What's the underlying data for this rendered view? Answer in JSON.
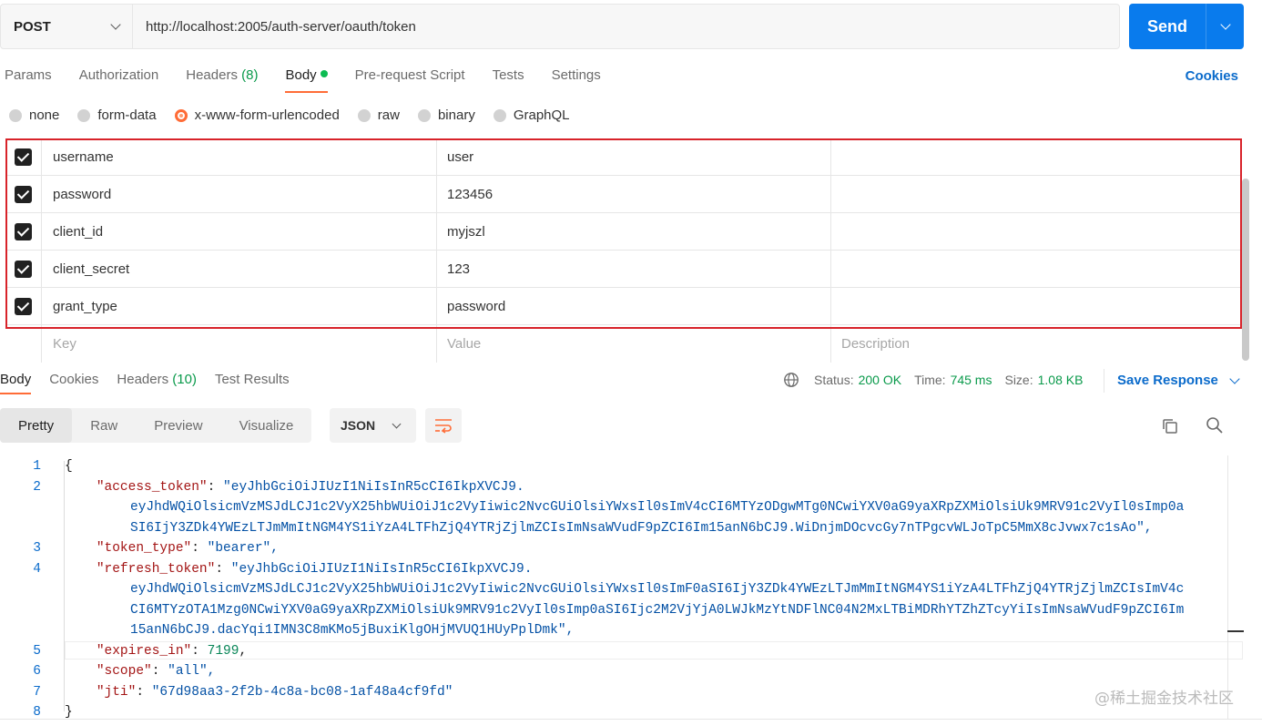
{
  "request": {
    "method": "POST",
    "url": "http://localhost:2005/auth-server/oauth/token",
    "send_label": "Send"
  },
  "request_tabs": [
    {
      "label": "Params"
    },
    {
      "label": "Authorization"
    },
    {
      "label": "Headers",
      "count": "(8)"
    },
    {
      "label": "Body",
      "active": true
    },
    {
      "label": "Pre-request Script"
    },
    {
      "label": "Tests"
    },
    {
      "label": "Settings"
    }
  ],
  "cookies_label": "Cookies",
  "body_types": [
    "none",
    "form-data",
    "x-www-form-urlencoded",
    "raw",
    "binary",
    "GraphQL"
  ],
  "body_type_selected": "x-www-form-urlencoded",
  "params": [
    {
      "key": "username",
      "value": "user",
      "checked": true
    },
    {
      "key": "password",
      "value": "123456",
      "checked": true
    },
    {
      "key": "client_id",
      "value": "myjszl",
      "checked": true
    },
    {
      "key": "client_secret",
      "value": "123",
      "checked": true
    },
    {
      "key": "grant_type",
      "value": "password",
      "checked": true
    }
  ],
  "params_placeholder": {
    "key": "Key",
    "value": "Value",
    "description": "Description"
  },
  "response_tabs": [
    {
      "label": "Body",
      "active": true
    },
    {
      "label": "Cookies"
    },
    {
      "label": "Headers",
      "count": "(10)"
    },
    {
      "label": "Test Results"
    }
  ],
  "response_status": {
    "status_label": "Status:",
    "status_value": "200 OK",
    "time_label": "Time:",
    "time_value": "745 ms",
    "size_label": "Size:",
    "size_value": "1.08 KB",
    "save_label": "Save Response"
  },
  "view_modes": [
    "Pretty",
    "Raw",
    "Preview",
    "Visualize"
  ],
  "view_mode_selected": "Pretty",
  "format": "JSON",
  "response_lines": [
    {
      "n": "1",
      "text": "{"
    },
    {
      "n": "2",
      "key": "\"access_token\"",
      "val": "\"eyJhbGciOiJIUzI1NiIsInR5cCI6IkpXVCJ9.",
      "cont": [
        "eyJhdWQiOlsicmVzMSJdLCJ1c2VyX25hbWUiOiJ1c2VyIiwic2NvcGUiOlsiYWxsIl0sImV4cCI6MTYzODgwMTg0NCwiYXV0aG9yaXRpZXMiOlsiUk9MRV91c2VyIl0sImp0a",
        "SI6IjY3ZDk4YWEzLTJmMmItNGM4YS1iYzA4LTFhZjQ4YTRjZjlmZCIsImNsaWVudF9pZCI6Im15anN6bCJ9.WiDnjmDOcvcGy7nTPgcvWLJoTpC5MmX8cJvwx7c1sAo\","
      ]
    },
    {
      "n": "3",
      "key": "\"token_type\"",
      "val": "\"bearer\","
    },
    {
      "n": "4",
      "key": "\"refresh_token\"",
      "val": "\"eyJhbGciOiJIUzI1NiIsInR5cCI6IkpXVCJ9.",
      "cont": [
        "eyJhdWQiOlsicmVzMSJdLCJ1c2VyX25hbWUiOiJ1c2VyIiwic2NvcGUiOlsiYWxsIl0sImF0aSI6IjY3ZDk4YWEzLTJmMmItNGM4YS1iYzA4LTFhZjQ4YTRjZjlmZCIsImV4c",
        "CI6MTYzOTA1Mzg0NCwiYXV0aG9yaXRpZXMiOlsiUk9MRV91c2VyIl0sImp0aSI6Ijc2M2VjYjA0LWJkMzYtNDFlNC04N2MxLTBiMDRhYTZhZTcyYiIsImNsaWVudF9pZCI6Im",
        "15anN6bCJ9.dacYqi1IMN3C8mKMo5jBuxiKlgOHjMVUQ1HUyPplDmk\","
      ]
    },
    {
      "n": "5",
      "key": "\"expires_in\"",
      "val": "7199",
      "num": true,
      "trail": ","
    },
    {
      "n": "6",
      "key": "\"scope\"",
      "val": "\"all\","
    },
    {
      "n": "7",
      "key": "\"jti\"",
      "val": "\"67d98aa3-2f2b-4c8a-bc08-1af48a4cf9fd\""
    },
    {
      "n": "8",
      "text": "}"
    }
  ],
  "watermark": "@稀土掘金技术社区",
  "colors": {
    "accent": "#ff6c37",
    "send": "#097bed",
    "link": "#0b6bcb",
    "success": "#0a9a4b",
    "highlight_border": "#d8232a"
  },
  "icons": [
    "chevron-down-icon",
    "globe-icon",
    "wrap-lines-icon",
    "copy-icon",
    "search-icon",
    "checkbox-checked-icon"
  ]
}
